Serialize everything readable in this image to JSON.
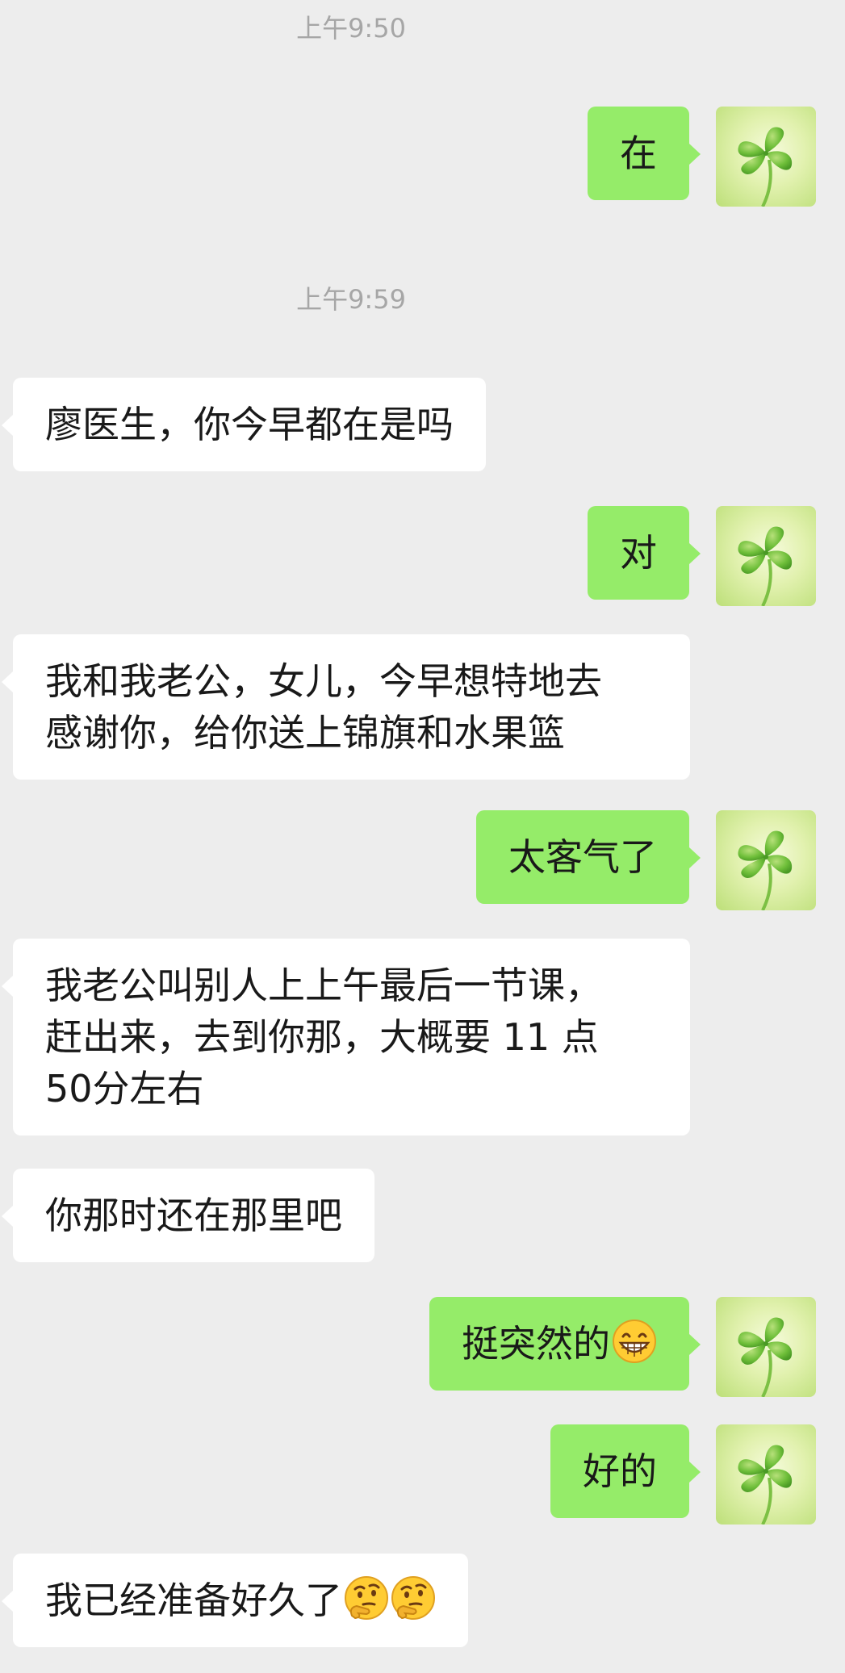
{
  "messages": [
    {
      "kind": "time",
      "text": "上午9:50"
    },
    {
      "kind": "sent",
      "lines": [
        "在"
      ]
    },
    {
      "kind": "time",
      "text": "上午9:59"
    },
    {
      "kind": "received",
      "lines": [
        "廖医生，你今早都在是吗"
      ]
    },
    {
      "kind": "sent",
      "lines": [
        "对"
      ]
    },
    {
      "kind": "received",
      "lines": [
        "我和我老公，女儿，今早想特地去",
        "感谢你，给你送上锦旗和水果篮"
      ]
    },
    {
      "kind": "sent",
      "lines": [
        "太客气了"
      ]
    },
    {
      "kind": "received",
      "lines": [
        "我老公叫别人上上午最后一节课，",
        "赶出来，去到你那，大概要 11 点",
        "50分左右"
      ]
    },
    {
      "kind": "received",
      "lines": [
        "你那时还在那里吧"
      ]
    },
    {
      "kind": "sent",
      "lines": [
        "挺突然的"
      ],
      "emoji": [
        "grin-emoji"
      ]
    },
    {
      "kind": "sent",
      "lines": [
        "好的"
      ]
    },
    {
      "kind": "received",
      "lines": [
        "我已经准备好久了"
      ],
      "emoji": [
        "thinking-emoji",
        "thinking-emoji"
      ]
    }
  ],
  "avatar": {
    "icon": "four-leaf-clover-icon"
  },
  "colors": {
    "background": "#ededed",
    "sent_bubble": "#95ec69",
    "received_bubble": "#ffffff",
    "timestamp_text": "#a6a6a6",
    "message_text": "#191919"
  }
}
